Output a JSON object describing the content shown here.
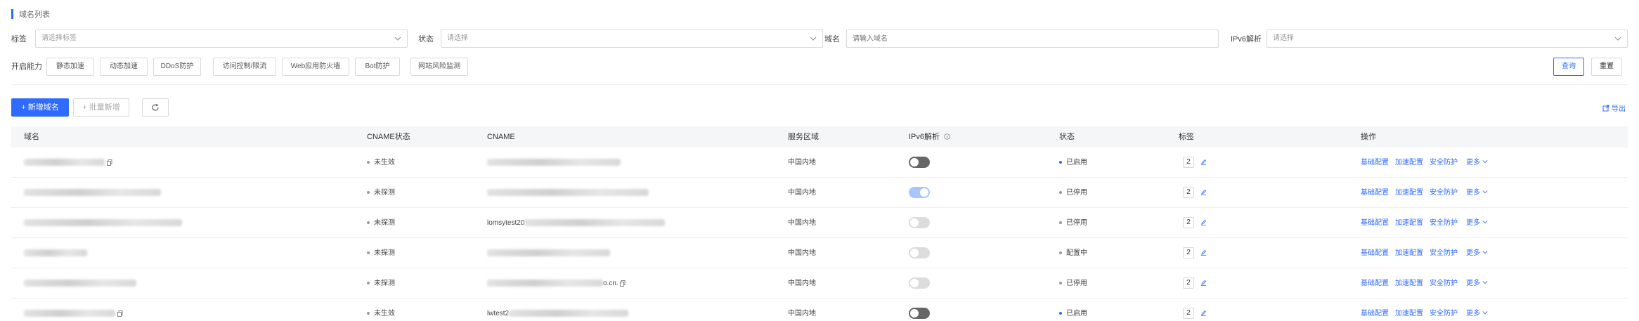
{
  "section": {
    "title": "域名列表"
  },
  "filters": {
    "tag_label": "标签",
    "tag_placeholder": "请选择标签",
    "status_label": "状态",
    "status_placeholder": "请选择",
    "domain_label": "域名",
    "domain_placeholder": "请输入域名",
    "ipv6_label": "IPv6解析",
    "ipv6_placeholder": "请选择"
  },
  "capabilities": {
    "label": "开启能力",
    "items": [
      "静态加速",
      "动态加速",
      "DDoS防护",
      "访问控制/限流",
      "Web应用防火墙",
      "Bot防护",
      "网站风险监测"
    ]
  },
  "actions": {
    "query": "查询",
    "reset": "重置",
    "add": "新增域名",
    "batch": "批量新增",
    "export": "导出"
  },
  "table": {
    "headers": [
      "域名",
      "CNAME状态",
      "CNAME",
      "服务区域",
      "IPv6解析",
      "状态",
      "标签",
      "操作"
    ],
    "rows": [
      {
        "cname_status": "未生效",
        "cname_status_color": "#999999",
        "region": "中国内地",
        "ipv6": "off",
        "status": "已启用",
        "status_color": "#2f6bff",
        "tags": "2"
      },
      {
        "cname_status": "未探测",
        "cname_status_color": "#999999",
        "region": "中国内地",
        "ipv6": "on-disabled",
        "status": "已停用",
        "status_color": "#999999",
        "tags": "2"
      },
      {
        "cname_status": "未探测",
        "cname_status_color": "#999999",
        "region": "中国内地",
        "ipv6": "off-disabled",
        "status": "已停用",
        "status_color": "#999999",
        "tags": "2",
        "cname_text": "lomsytest20"
      },
      {
        "cname_status": "未探测",
        "cname_status_color": "#999999",
        "region": "中国内地",
        "ipv6": "off-disabled",
        "status": "配置中",
        "status_color": "#999999",
        "tags": "2"
      },
      {
        "cname_status": "未探测",
        "cname_status_color": "#999999",
        "region": "中国内地",
        "ipv6": "off-disabled",
        "status": "已停用",
        "status_color": "#999999",
        "tags": "2",
        "cname_suffix": "o.cn."
      },
      {
        "cname_status": "未生效",
        "cname_status_color": "#999999",
        "region": "中国内地",
        "ipv6": "off",
        "status": "已启用",
        "status_color": "#2f6bff",
        "tags": "2",
        "cname_text": "lwtest2"
      }
    ],
    "ops": [
      "基础配置",
      "加速配置",
      "安全防护",
      "更多"
    ]
  }
}
